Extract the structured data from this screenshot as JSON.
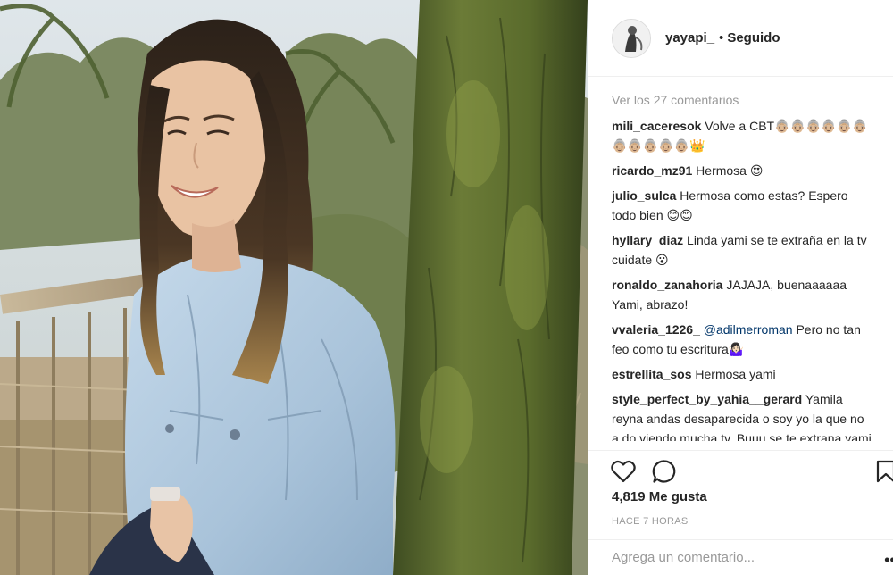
{
  "header": {
    "username": "yayapi_",
    "separator": "•",
    "follow_status": "Seguido"
  },
  "comments": {
    "view_all": "Ver los 27 comentarios",
    "items": [
      {
        "user": "mili_caceresok",
        "text": "Volve a CBT👵🏼👵🏼👵🏼👵🏼👵🏼👵🏼👵🏼👵🏼👵🏼👵🏼👵🏼👑"
      },
      {
        "user": "ricardo_mz91",
        "text": "Hermosa 😍"
      },
      {
        "user": "julio_sulca",
        "text": "Hermosa como estas? Espero todo bien 😊😊"
      },
      {
        "user": "hyllary_diaz",
        "text": "Linda yami se te extraña en la tv cuidate 😮"
      },
      {
        "user": "ronaldo_zanahoria",
        "text": "JAJAJA, buenaaaaaa Yami, abrazo!"
      },
      {
        "user": "vvaleria_1226_",
        "mention": "@adilmerroman",
        "text": "Pero no tan feo como tu escritura🤷🏻‍♀️"
      },
      {
        "user": "estrellita_sos",
        "text": "Hermosa yami"
      },
      {
        "user": "style_perfect_by_yahia__gerard",
        "text": "Yamila reyna andas desaparecida o soy yo la que no a do viendo mucha tv. Buuu se te extrana yami tus ocurrencias eres lo"
      }
    ]
  },
  "actions": {
    "like_icon": "heart-icon",
    "comment_icon": "speech-bubble-icon",
    "save_icon": "bookmark-icon"
  },
  "likes": "4,819 Me gusta",
  "time_ago": "HACE 7 HORAS",
  "add_comment": {
    "placeholder": "Agrega un comentario...",
    "more_icon": "more-dots-icon"
  },
  "colors": {
    "text": "#262626",
    "muted": "#999999",
    "mention": "#003569",
    "border": "#efefef"
  }
}
